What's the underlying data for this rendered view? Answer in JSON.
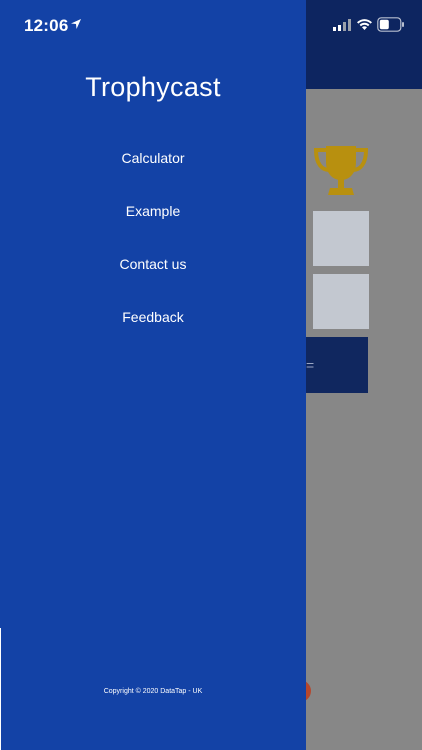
{
  "status_bar": {
    "time": "12:06",
    "icons": [
      "location-arrow-icon",
      "cellular-signal-icon",
      "wifi-icon",
      "battery-icon"
    ]
  },
  "drawer": {
    "title": "Trophycast",
    "menu": [
      {
        "label": "Calculator"
      },
      {
        "label": "Example"
      },
      {
        "label": "Contact us"
      },
      {
        "label": "Feedback"
      }
    ],
    "copyright": "Copyright © 2020 DataTap - UK"
  },
  "background": {
    "button_label": "=",
    "icons": [
      "trophy-icon"
    ]
  },
  "colors": {
    "drawer_bg": "#1342a6",
    "header_bg": "#0d2560",
    "trophy": "#b8900f",
    "overlay": "#878787"
  }
}
